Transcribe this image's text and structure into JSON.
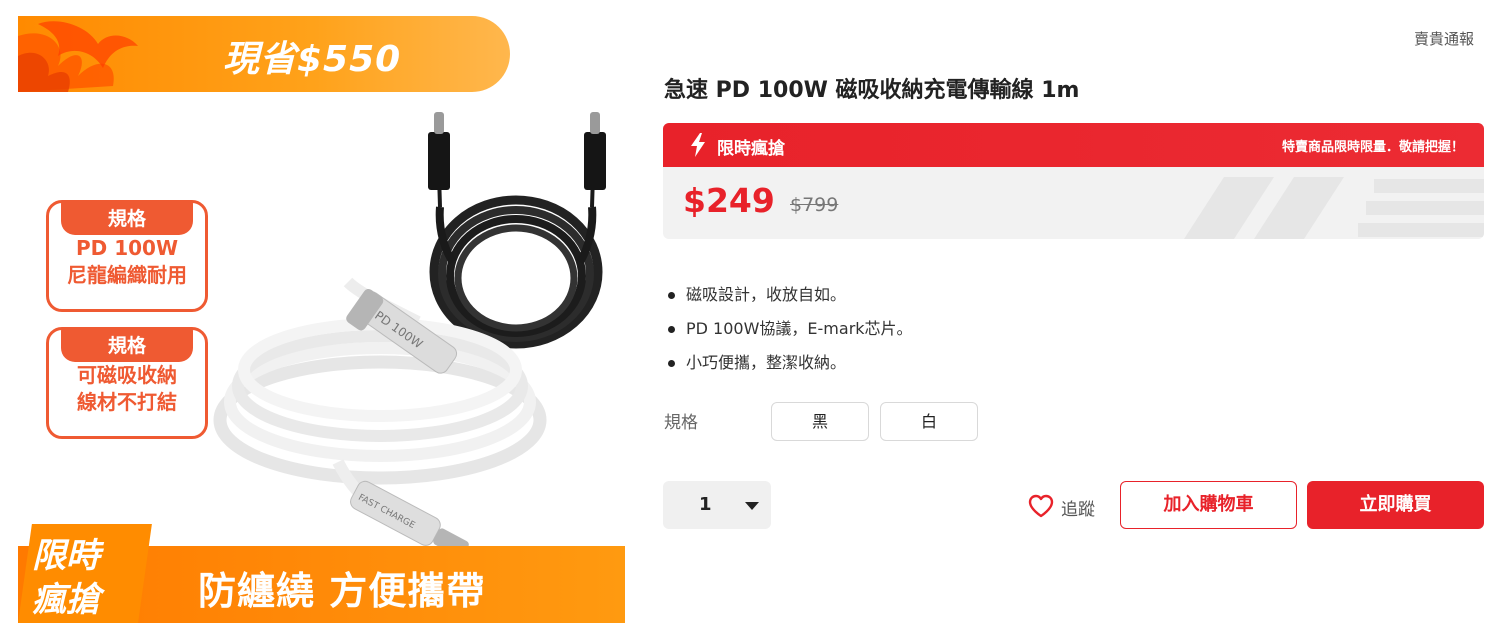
{
  "image": {
    "save_banner": "現省$550",
    "badges": [
      {
        "head": "規格",
        "lines": [
          "PD 100W",
          "尼龍編織耐用"
        ]
      },
      {
        "head": "規格",
        "lines": [
          "可磁吸收納",
          "線材不打結"
        ]
      }
    ],
    "flash_line1": "限時",
    "flash_line2": "瘋搶",
    "slogan": "防纏繞 方便攜帶",
    "connector_label_white": "PD 100W",
    "connector_label_bottom": "FAST CHARGE",
    "colors": {
      "orange": "#ff8a00",
      "badge_red": "#ef5a32"
    }
  },
  "report_link": "賣貴通報",
  "title": "急速 PD 100W 磁吸收納充電傳輸線 1m",
  "flash_sale": {
    "icon": "lightning-icon",
    "label": "限時瘋搶",
    "note": "特賣商品限時限量．敬請把握！",
    "price": "$249",
    "original_price": "$799",
    "accent_color": "#e8222a"
  },
  "features": [
    "磁吸設計，收放自如。",
    "PD 100W協議，E-mark芯片。",
    "小巧便攜，整潔收納。"
  ],
  "spec": {
    "label": "規格",
    "options": [
      "黑",
      "白"
    ]
  },
  "quantity": {
    "value": "1",
    "icon": "caret-down-icon"
  },
  "follow": {
    "icon": "heart-icon",
    "label": "追蹤"
  },
  "buttons": {
    "add_to_cart": "加入購物車",
    "buy_now": "立即購買"
  }
}
